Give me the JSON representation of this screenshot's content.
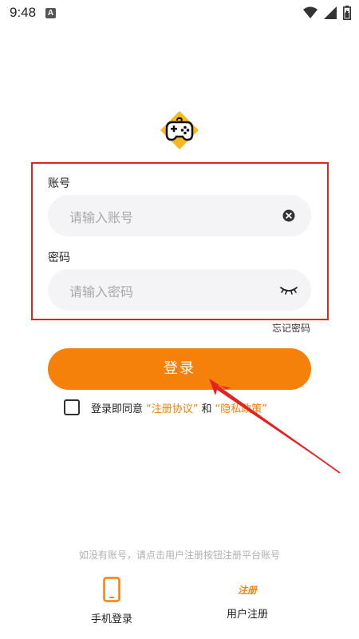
{
  "status_bar": {
    "time": "9:48",
    "badge": "A"
  },
  "form": {
    "account_label": "账号",
    "account_placeholder": "请输入账号",
    "password_label": "密码",
    "password_placeholder": "请输入密码",
    "forgot_password": "忘记密码"
  },
  "login_button": "登录",
  "agreement": {
    "prefix": "登录即同意",
    "terms": "“注册协议”",
    "and": "和",
    "privacy": "“隐私政策”"
  },
  "hint": "如没有账号，请点击用户注册按钮注册平台账号",
  "bottom": {
    "phone_login": "手机登录",
    "register_icon_text": "注册",
    "user_register": "用户注册"
  },
  "colors": {
    "accent": "#f5800a",
    "highlight_box": "#e52222",
    "logo_bg": "#f5b820"
  },
  "icons": [
    "wifi-icon",
    "signal-icon",
    "battery-icon",
    "gamepad-icon",
    "clear-icon",
    "eye-closed-icon",
    "phone-icon"
  ]
}
